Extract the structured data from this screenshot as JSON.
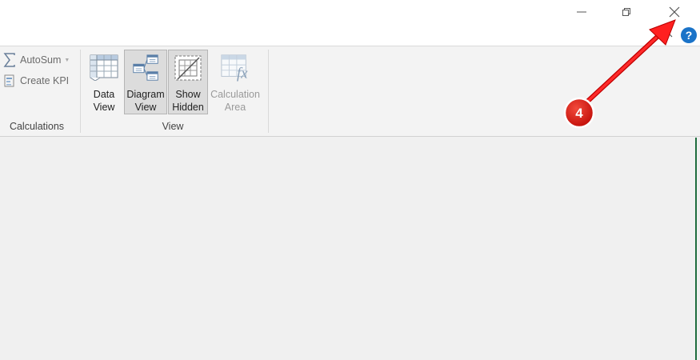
{
  "window_controls": {
    "minimize_icon": "minimize-icon",
    "restore_icon": "restore-icon",
    "close_icon": "close-icon",
    "collapse_icon": "chevron-up-icon",
    "help_label": "?"
  },
  "ribbon": {
    "calculations": {
      "label": "Calculations",
      "autosum_label": "AutoSum",
      "create_kpi_label": "Create KPI"
    },
    "view": {
      "label": "View",
      "data_view_label": "Data\nView",
      "diagram_view_label": "Diagram\nView",
      "show_hidden_label": "Show\nHidden",
      "calculation_area_label": "Calculation\nArea"
    }
  },
  "annotation": {
    "step_label": "4",
    "color": "#e02020"
  }
}
